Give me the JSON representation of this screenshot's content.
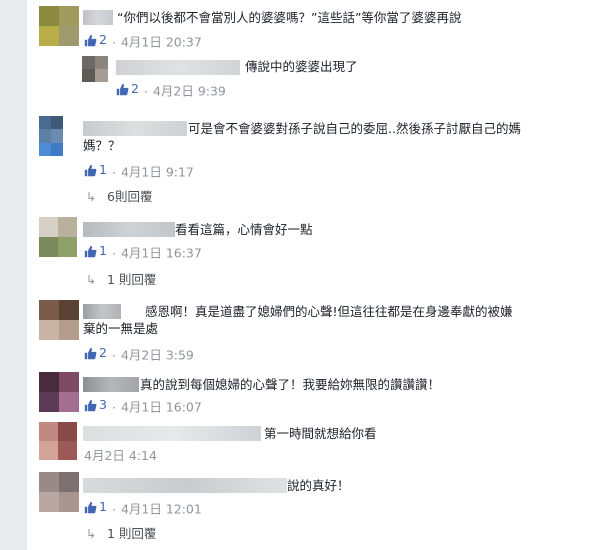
{
  "comments": [
    {
      "text": "“你們以後都不會當別人的婆婆嗎？”這些話”等你當了婆婆再說",
      "likes": "2",
      "time": "4月1日 20:37"
    },
    {
      "text": "傳說中的婆婆出現了",
      "likes": "2",
      "time": "4月2日 9:39"
    },
    {
      "text_line1": "可是會不會婆婆對孫子說自己的委屈..然後孫子討厭自己的媽",
      "text_line2": "媽？？",
      "likes": "1",
      "time": "4月1日 9:17",
      "replies": "6則回覆"
    },
    {
      "text": "看看這篇，心情會好一點",
      "likes": "1",
      "time": "4月1日 16:37",
      "replies": "1 則回覆"
    },
    {
      "text_line1": "感恩啊！真是道盡了媳婦們的心聲!但這往往都是在身邊奉獻的被嫌",
      "text_line2": "棄的一無是處",
      "likes": "2",
      "time": "4月2日 3:59"
    },
    {
      "text": "真的說到每個媳婦的心聲了！我要給妳無限的讚讚讚！",
      "likes": "3",
      "time": "4月1日 16:07"
    },
    {
      "text": "第一時間就想給你看",
      "time": "4月2日 4:14"
    },
    {
      "text": "說的真好！",
      "likes": "1",
      "time": "4月1日 12:01",
      "replies": "1 則回覆"
    }
  ],
  "separator": "·",
  "colors": {
    "link": "#4267b2",
    "meta": "#90949c",
    "text": "#1d2129",
    "reply_text": "#4b4f56"
  },
  "icons": {
    "like": "thumbs-up-icon",
    "reply": "reply-arrow-icon"
  }
}
